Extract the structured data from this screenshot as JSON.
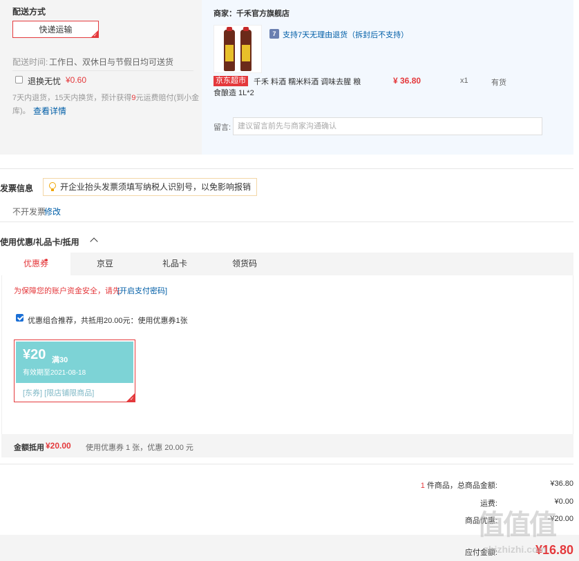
{
  "shipping": {
    "section_title": "配送方式",
    "method_button": "快递运输",
    "delivery_time_label": "配送时间:",
    "delivery_time_value": "工作日、双休日与节假日均可送货",
    "return_insurance_label": "退换无忧",
    "return_insurance_price": "¥0.60",
    "return_insurance_desc_1": "7天内退货，15天内换货，预计获得",
    "return_insurance_highlight": "9",
    "return_insurance_desc_2": "元运费赔付(到小金",
    "return_insurance_desc_3": "库)。",
    "return_insurance_link": "查看详情"
  },
  "merchant": {
    "label": "商家：千禾官方旗舰店",
    "return_policy": "支持7天无理由退货（拆封后不支持）",
    "return_icon": "7",
    "product": {
      "tag": "京东超市",
      "name_line1": "千禾 料酒 糯米料酒 调味去腥 粮",
      "name_line2": "食酿造 1L*2",
      "price": "¥ 36.80",
      "quantity": "x1",
      "stock": "有货"
    },
    "message_label": "留言:",
    "message_placeholder": "建议留言前先与商家沟通确认"
  },
  "invoice": {
    "title": "发票信息",
    "tip": "开企业抬头发票须填写纳税人识别号，以免影响报销",
    "current": "不开发票",
    "modify_link": "修改"
  },
  "discounts": {
    "title": "使用优惠/礼品卡/抵用",
    "tabs": [
      "优惠券",
      "京豆",
      "礼品卡",
      "领货码"
    ],
    "security_tip": "为保障您的账户资金安全，请先",
    "security_link": "[开启支付密码]",
    "combo_label": "优惠组合推荐，共抵用20.00元：使用优惠券1张",
    "coupon": {
      "amount": "¥20",
      "condition": "满30",
      "validity": "有效期至2021-08-18",
      "tags": "[东券] [限店铺限商品]"
    },
    "summary_label": "金额抵用",
    "summary_amount": "¥20.00",
    "summary_desc": "使用优惠券 1 张，优惠 20.00 元"
  },
  "totals": {
    "item_count": "1",
    "items_label": "件商品，总商品金额:",
    "items_amount": "¥36.80",
    "shipping_label": "运费:",
    "shipping_amount": "¥0.00",
    "discount_label": "商品优惠:",
    "discount_amount": "-¥20.00",
    "payable_label": "应付金额:",
    "payable_amount": "¥16.80"
  },
  "watermark": {
    "glyphs": "值值值",
    "url": "zhizhizhi.com"
  },
  "colors": {
    "accent_red": "#e4393c",
    "link_blue": "#005ea7",
    "coupon_teal": "#7dd3d6"
  }
}
